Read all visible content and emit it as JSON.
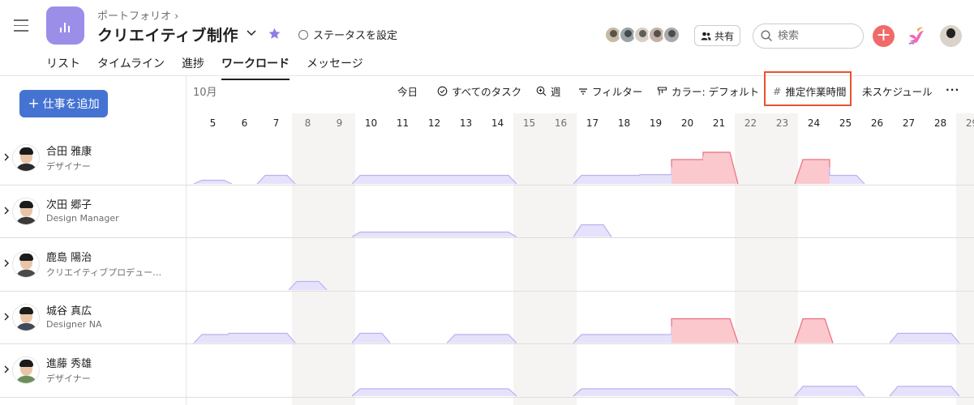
{
  "header": {
    "breadcrumb": "ポートフォリオ ›",
    "project_title": "クリエイティブ制作",
    "status_label": "ステータスを設定",
    "share_label": "共有",
    "search_placeholder": "検索",
    "brand_color": "#9b8ee8"
  },
  "tabs": [
    {
      "label": "リスト"
    },
    {
      "label": "タイムライン"
    },
    {
      "label": "進捗"
    },
    {
      "label": "ワークロード",
      "active": true
    },
    {
      "label": "メッセージ"
    }
  ],
  "toolbar": {
    "add_task_label": "仕事を追加",
    "month": "10月",
    "today": "今日",
    "all_tasks": "すべてのタスク",
    "week": "週",
    "filter": "フィルター",
    "color": "カラー: デフォルト",
    "estimate": "推定作業時間",
    "unscheduled": "未スケジュール",
    "more": "···"
  },
  "days": [
    {
      "label": "5",
      "weekend": false
    },
    {
      "label": "6",
      "weekend": false
    },
    {
      "label": "7",
      "weekend": false
    },
    {
      "label": "8",
      "weekend": true
    },
    {
      "label": "9",
      "weekend": true
    },
    {
      "label": "10",
      "weekend": false
    },
    {
      "label": "11",
      "weekend": false
    },
    {
      "label": "12",
      "weekend": false
    },
    {
      "label": "13",
      "weekend": false
    },
    {
      "label": "14",
      "weekend": false
    },
    {
      "label": "15",
      "weekend": true
    },
    {
      "label": "16",
      "weekend": true
    },
    {
      "label": "17",
      "weekend": false
    },
    {
      "label": "18",
      "weekend": false
    },
    {
      "label": "19",
      "weekend": false
    },
    {
      "label": "20",
      "weekend": false
    },
    {
      "label": "21",
      "weekend": false
    },
    {
      "label": "22",
      "weekend": true
    },
    {
      "label": "23",
      "weekend": true
    },
    {
      "label": "24",
      "weekend": false
    },
    {
      "label": "25",
      "weekend": false
    },
    {
      "label": "26",
      "weekend": false
    },
    {
      "label": "27",
      "weekend": false
    },
    {
      "label": "28",
      "weekend": false
    },
    {
      "label": "29",
      "weekend": true
    }
  ],
  "people": [
    {
      "name": "合田 雅康",
      "role": "デザイナー",
      "shirt": "#2b2b2b",
      "load": [
        0.15,
        0,
        0.35,
        0,
        0,
        0.35,
        0.35,
        0.35,
        0.35,
        0.35,
        0,
        0,
        0.35,
        0.35,
        0.38,
        1.0,
        1.3,
        0,
        0,
        1.0,
        0.35,
        0,
        0,
        0,
        0
      ]
    },
    {
      "name": "次田 郷子",
      "role": "Design Manager",
      "shirt": "#3a3a3a",
      "load": [
        0,
        0,
        0,
        0,
        0,
        0.2,
        0.2,
        0.2,
        0.2,
        0.2,
        0,
        0,
        0.5,
        0,
        0,
        0,
        0,
        0,
        0,
        0,
        0,
        0,
        0,
        0,
        0
      ]
    },
    {
      "name": "鹿島 陽治",
      "role": "クリエイティブプロデュー…",
      "shirt": "#4a4a4a",
      "load": [
        0,
        0,
        0,
        0.35,
        0,
        0,
        0,
        0,
        0,
        0,
        0,
        0,
        0,
        0,
        0,
        0,
        0,
        0,
        0,
        0,
        0,
        0,
        0,
        0,
        0
      ]
    },
    {
      "name": "城谷 真広",
      "role": "Designer NA",
      "shirt": "#3e4a5a",
      "load": [
        0.35,
        0.4,
        0.4,
        0,
        0,
        0.4,
        0,
        0,
        0.35,
        0.35,
        0,
        0,
        0.35,
        0.35,
        0.35,
        1.0,
        1.0,
        0,
        0,
        1.0,
        0,
        0,
        0.4,
        0.4,
        0
      ]
    },
    {
      "name": "進藤 秀雄",
      "role": "デザイナー",
      "shirt": "#6b8f5a",
      "load": [
        0,
        0,
        0,
        0,
        0,
        0.3,
        0.3,
        0.3,
        0.3,
        0.3,
        0,
        0,
        0.3,
        0.3,
        0.3,
        0.3,
        0.3,
        0,
        0,
        0.4,
        0.4,
        0,
        0.4,
        0.4,
        0
      ]
    }
  ],
  "colors": {
    "under": "#b9b1f2",
    "under_fill": "#e6e2fb",
    "over": "#ee6d7e",
    "over_fill": "#fac8cd",
    "accent": "#4573d2",
    "highlight": "#e8532f"
  }
}
